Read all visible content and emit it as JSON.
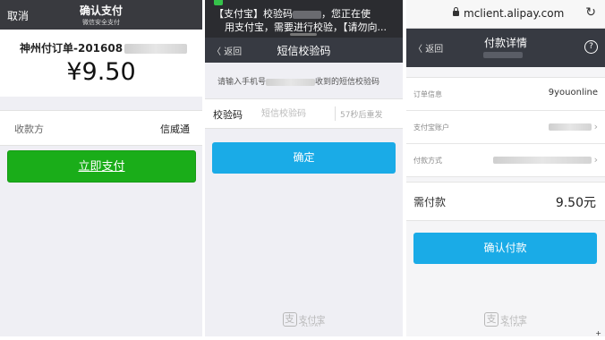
{
  "wechat": {
    "cancel_label": "取消",
    "title": "确认支付",
    "subtitle": "微信安全支付",
    "order_name": "神州付订单-201608",
    "amount": "¥9.50",
    "payee_label": "收款方",
    "payee_value": "信威通",
    "pay_button": "立即支付"
  },
  "sms": {
    "notif_line1_a": "【支付宝】校验码",
    "notif_line1_b": "，您正在使",
    "notif_line2": "用支付宝，需要进行校验，【请勿向...",
    "back_label": "返回",
    "title": "短信校验码",
    "hint_prefix": "请输入手机号",
    "hint_suffix": "收到的短信校验码",
    "code_label": "校验码",
    "code_placeholder": "短信校验码",
    "countdown": "57秒后重发",
    "confirm_button": "确定"
  },
  "alipay": {
    "url": "mclient.alipay.com",
    "back_label": "返回",
    "title": "付款详情",
    "help_label": "?",
    "rows": [
      {
        "label": "订单信息",
        "value": "9youonline"
      },
      {
        "label": "支付宝账户",
        "value": ""
      },
      {
        "label": "付款方式",
        "value": ""
      }
    ],
    "due_label": "需付款",
    "due_value": "9.50元",
    "confirm_button": "确认付款"
  },
  "logo": {
    "mark": "支",
    "cn": "支付宝",
    "en": "ALIPAY"
  },
  "stray_mark": "+",
  "colors": {
    "wechat_green": "#1aad19",
    "alipay_blue": "#1aabe7",
    "nav_dark": "#373a42"
  }
}
